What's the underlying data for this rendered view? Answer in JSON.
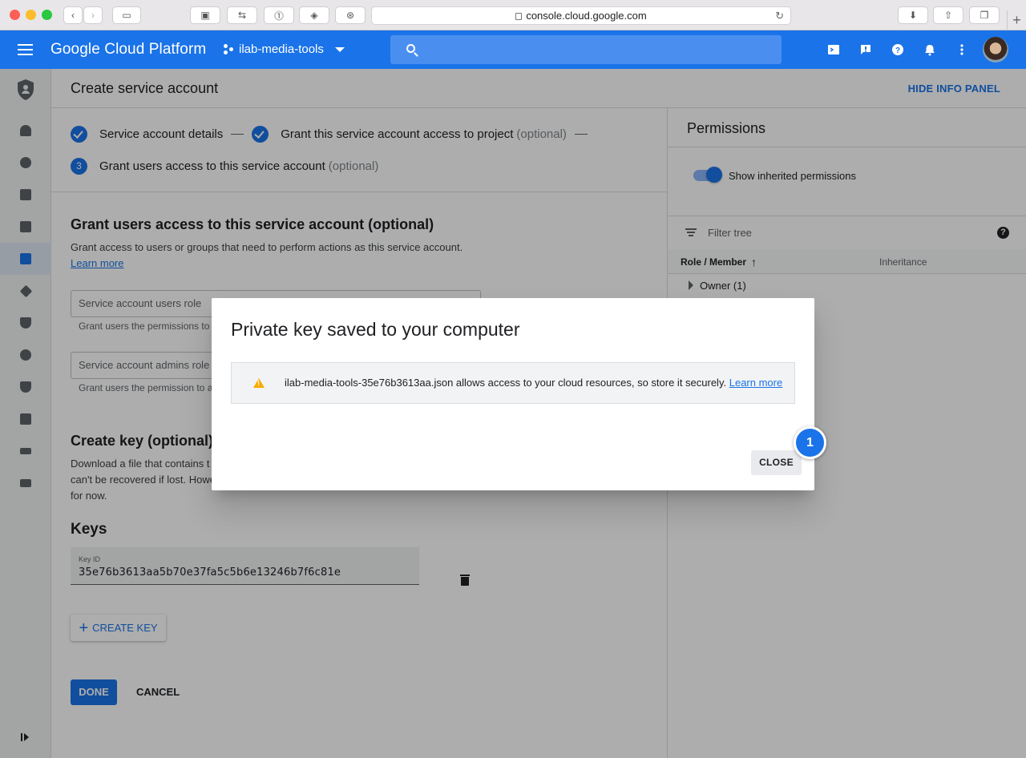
{
  "browser": {
    "url": "console.cloud.google.com"
  },
  "header": {
    "brand": "Google Cloud Platform",
    "project": "ilab-media-tools",
    "accent": "#1a73e8"
  },
  "page": {
    "title": "Create service account",
    "hide_info_label": "HIDE INFO PANEL"
  },
  "steps": {
    "step1": "Service account details",
    "step2": "Grant this service account access to project",
    "step2_opt": "(optional)",
    "step3_num": "3",
    "step3": "Grant users access to this service account",
    "step3_opt": "(optional)"
  },
  "grant": {
    "heading": "Grant users access to this service account (optional)",
    "desc": "Grant access to users or groups that need to perform actions as this service account.",
    "learn_more": "Learn more",
    "users_role_placeholder": "Service account users role",
    "users_role_hint": "Grant users the permissions to",
    "admins_role_placeholder": "Service account admins role",
    "admins_role_hint": "Grant users the permission to a"
  },
  "create_key": {
    "heading": "Create key (optional)",
    "desc_line1": "Download a file that contains t",
    "desc_line2": "can't be recovered if lost. Howe",
    "desc_line3": "for now."
  },
  "keys": {
    "heading": "Keys",
    "key_id_label": "Key ID",
    "key_id_value": "35e76b3613aa5b70e37fa5c5b6e13246b7f6c81e",
    "create_key_label": "CREATE KEY"
  },
  "actions": {
    "done": "DONE",
    "cancel": "CANCEL"
  },
  "permissions": {
    "title": "Permissions",
    "toggle_label": "Show inherited permissions",
    "toggle_on": true,
    "filter_placeholder": "Filter tree",
    "col_role": "Role / Member",
    "col_inheritance": "Inheritance",
    "owner_row": "Owner (1)"
  },
  "dialog": {
    "title": "Private key saved to your computer",
    "message": "ilab-media-tools-35e76b3613aa.json allows access to your cloud resources, so store it securely.",
    "learn_more": "Learn more",
    "close": "CLOSE"
  },
  "annotation": {
    "badge_number": "1"
  }
}
